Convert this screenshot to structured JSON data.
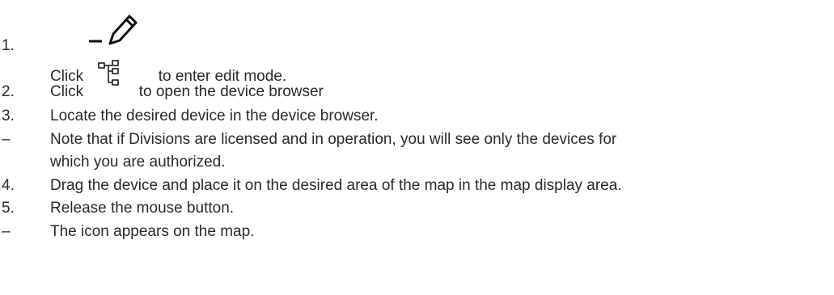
{
  "steps": [
    {
      "marker": "1.",
      "before_icon": "Click",
      "icon": "pencil-edit-icon",
      "after_icon": "to enter edit mode."
    },
    {
      "marker": "2.",
      "before_icon": "Click",
      "icon": "device-tree-icon",
      "after_icon": "to open the device browser"
    },
    {
      "marker": "3.",
      "text": "Locate the desired device in the device browser."
    },
    {
      "marker": "–",
      "lines": [
        "Note that if Divisions are licensed and in operation, you will see only the devices for",
        "which you are authorized."
      ]
    },
    {
      "marker": "4.",
      "text": "Drag the device and place it on the desired area of the map in the map display area."
    },
    {
      "marker": "5.",
      "text": "Release the mouse button."
    },
    {
      "marker": "–",
      "text": "The icon appears on the map."
    }
  ]
}
